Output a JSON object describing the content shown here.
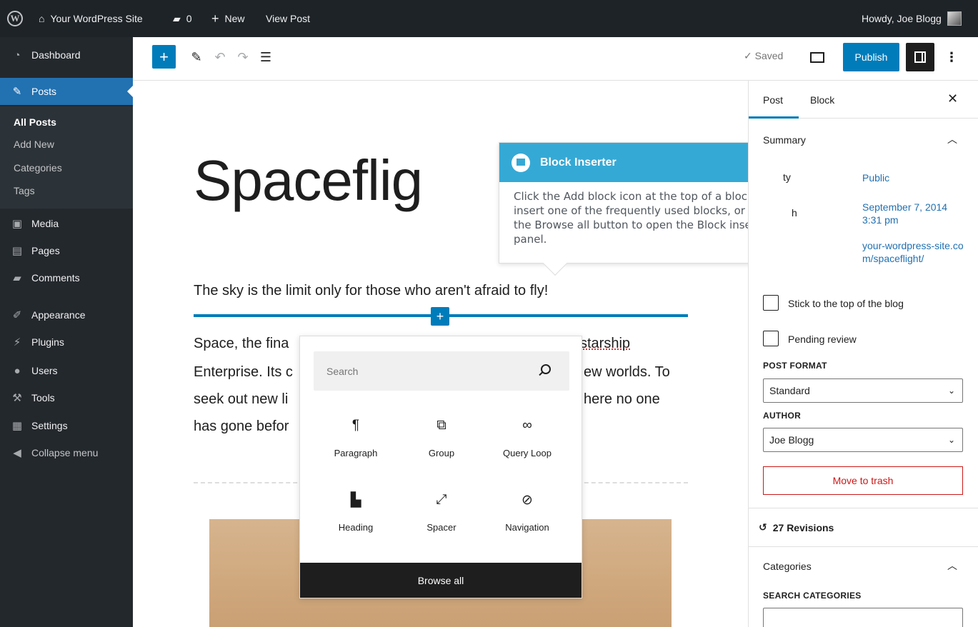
{
  "adminbar": {
    "site_name": "Your WordPress Site",
    "comments_count": "0",
    "new_label": "New",
    "view_post_label": "View Post",
    "howdy": "Howdy, Joe Blogg"
  },
  "sidebar": {
    "dashboard": "Dashboard",
    "posts": "Posts",
    "submenu": [
      "All Posts",
      "Add New",
      "Categories",
      "Tags"
    ],
    "media": "Media",
    "pages": "Pages",
    "comments": "Comments",
    "appearance": "Appearance",
    "plugins": "Plugins",
    "users": "Users",
    "tools": "Tools",
    "settings": "Settings",
    "collapse": "Collapse menu"
  },
  "toolbar": {
    "saved": "✓ Saved",
    "publish": "Publish"
  },
  "post": {
    "title": "Spaceflig",
    "subtitle": "The sky is the limit only for those who aren't afraid to fly!",
    "body_lines": [
      {
        "a": "Space, the fina",
        "b": "starship"
      },
      {
        "a": "Enterprise. Its c",
        "b": "ew worlds. To"
      },
      {
        "a": "seek out new li",
        "b": "here no one"
      },
      {
        "a": "has gone befor",
        "b": ""
      }
    ]
  },
  "inserter": {
    "search_placeholder": "Search",
    "blocks": [
      {
        "label": "Paragraph",
        "icon": "¶"
      },
      {
        "label": "Group",
        "icon": "⧉"
      },
      {
        "label": "Query Loop",
        "icon": "∞"
      },
      {
        "label": "Heading",
        "icon": "▙"
      },
      {
        "label": "Spacer",
        "icon": "⤢"
      },
      {
        "label": "Navigation",
        "icon": "⊘"
      }
    ],
    "browse_all": "Browse all"
  },
  "tooltip": {
    "title": "Block Inserter",
    "body": "Click the Add block icon at the top of a block to insert one of the frequently used blocks, or click the Browse all button to open the Block inserter panel."
  },
  "panel": {
    "tab_post": "Post",
    "tab_block": "Block",
    "summary": "Summary",
    "visibility_label": "ty",
    "visibility_value": "Public",
    "publish_label": "h",
    "publish_value": "September 7, 2014 3:31 pm",
    "url_value": "your-wordpress-site.com/spaceflight/",
    "stick_top": "Stick to the top of the blog",
    "pending_review": "Pending review",
    "post_format_label": "POST FORMAT",
    "post_format_value": "Standard",
    "author_label": "AUTHOR",
    "author_value": "Joe Blogg",
    "move_to_trash": "Move to trash",
    "revisions": "27 Revisions",
    "categories": "Categories",
    "search_categories": "SEARCH CATEGORIES"
  },
  "colors": {
    "admin_bar": "#1d2327",
    "accent": "#007cba",
    "tooltip_header": "#35a9d5",
    "danger": "#cc1818"
  }
}
